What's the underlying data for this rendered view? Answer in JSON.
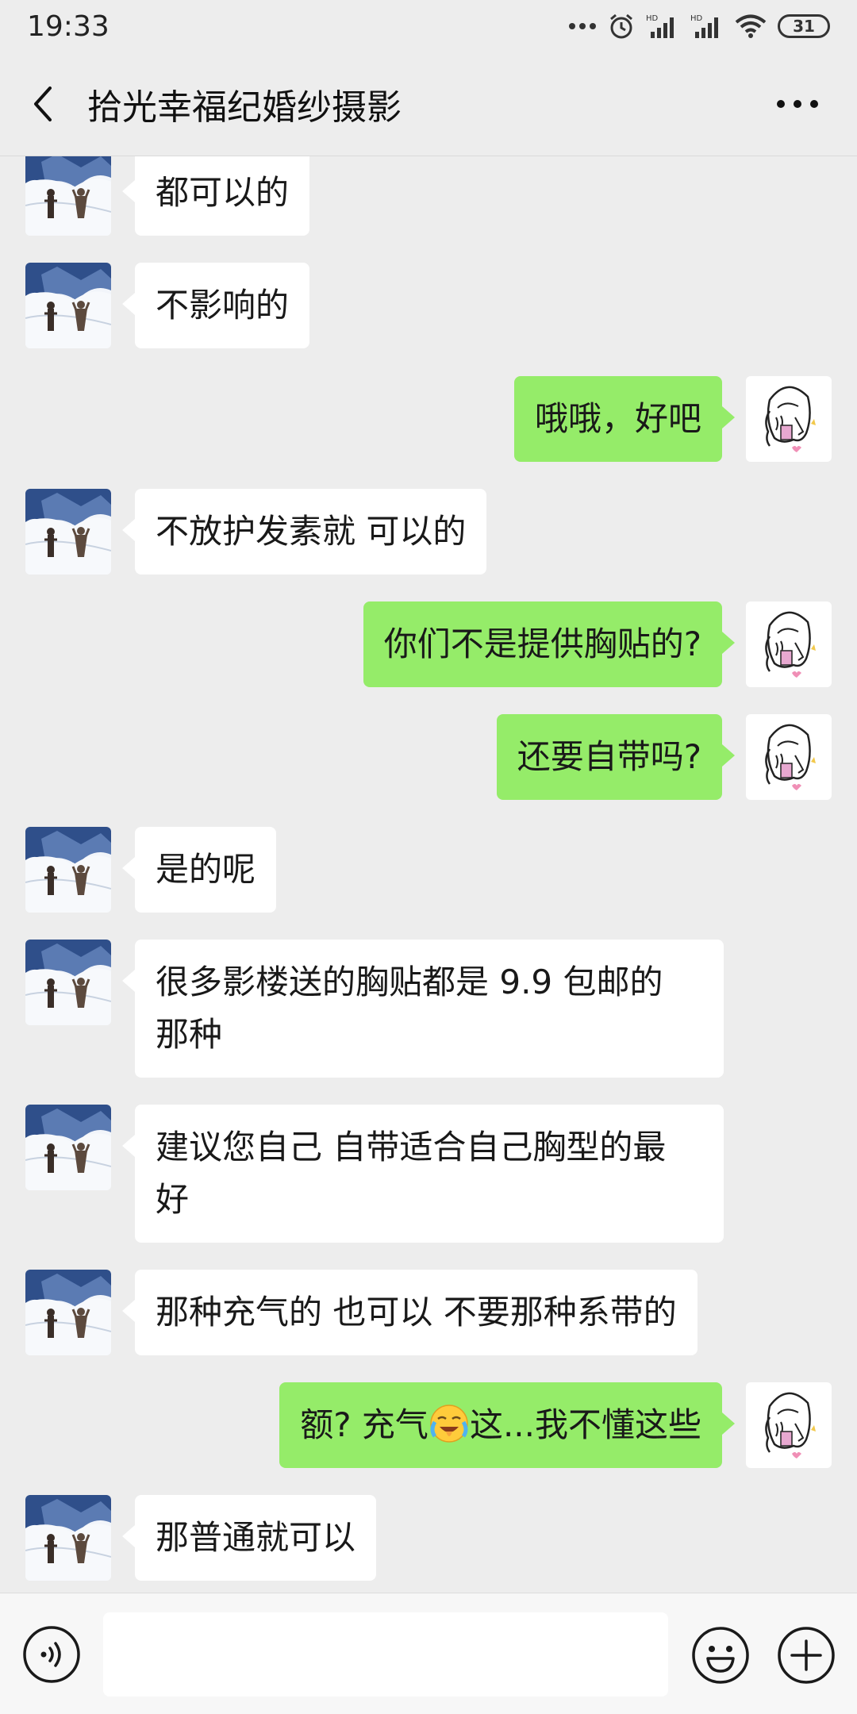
{
  "status_bar": {
    "time": "19:33",
    "battery": "31",
    "icons": [
      "more-dots-icon",
      "alarm-icon",
      "hd-signal-icon",
      "hd-signal-icon",
      "wifi-icon",
      "battery-icon"
    ]
  },
  "header": {
    "title": "拾光幸福纪婚纱摄影",
    "back_icon": "chevron-left-icon",
    "more_icon": "more-horizontal-icon"
  },
  "messages": [
    {
      "side": "left",
      "text": "都可以的"
    },
    {
      "side": "left",
      "text": "不影响的"
    },
    {
      "side": "right",
      "text": "哦哦，好吧"
    },
    {
      "side": "left",
      "text": "不放护发素就 可以的"
    },
    {
      "side": "right",
      "text": "你们不是提供胸贴的?"
    },
    {
      "side": "right",
      "text": "还要自带吗?"
    },
    {
      "side": "left",
      "text": "是的呢"
    },
    {
      "side": "left",
      "text": "很多影楼送的胸贴都是 9.9 包邮的\n那种"
    },
    {
      "side": "left",
      "text": "建议您自己 自带适合自己胸型的最\n好"
    },
    {
      "side": "left",
      "text": "那种充气的 也可以 不要那种系带的"
    },
    {
      "side": "right",
      "text_before": "额? 充气",
      "emoji": "laughing-crying-emoji",
      "text_after": "这...我不懂这些"
    },
    {
      "side": "left",
      "text": "那普通就可以"
    }
  ],
  "input_bar": {
    "voice_icon": "voice-icon",
    "input_value": "",
    "emoji_icon": "smiley-icon",
    "plus_icon": "plus-icon"
  }
}
